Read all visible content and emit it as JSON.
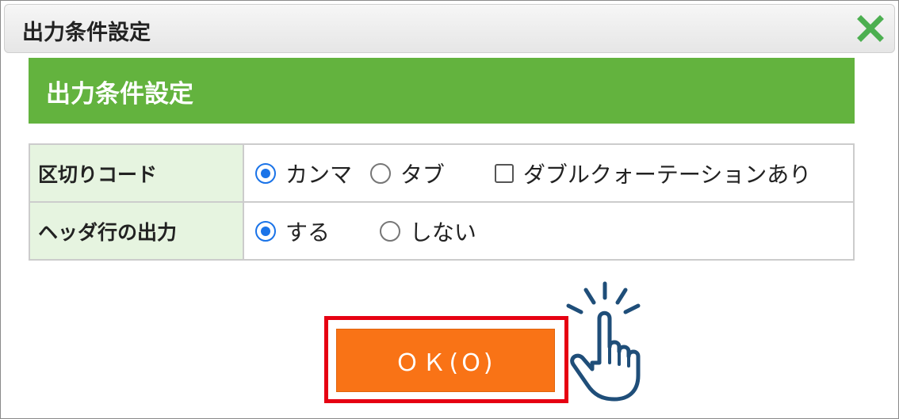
{
  "dialog": {
    "title": "出力条件設定",
    "close_icon": "close-x-icon",
    "close_color": "#4caf50"
  },
  "section": {
    "heading": "出力条件設定",
    "color": "#63b33e"
  },
  "rows": [
    {
      "label": "区切りコード",
      "options": [
        {
          "label": "カンマ",
          "type": "radio",
          "selected": true
        },
        {
          "label": "タブ",
          "type": "radio",
          "selected": false
        },
        {
          "label": "ダブルクォーテーションあり",
          "type": "checkbox",
          "checked": false
        }
      ]
    },
    {
      "label": "ヘッダ行の出力",
      "options": [
        {
          "label": "する",
          "type": "radio",
          "selected": true
        },
        {
          "label": "しない",
          "type": "radio",
          "selected": false
        }
      ]
    }
  ],
  "ok_button": {
    "label": "ＯＫ(O)",
    "color": "#f97316",
    "highlight_color": "#e60012"
  },
  "pointer_icon": "hand-pointer-click-icon"
}
